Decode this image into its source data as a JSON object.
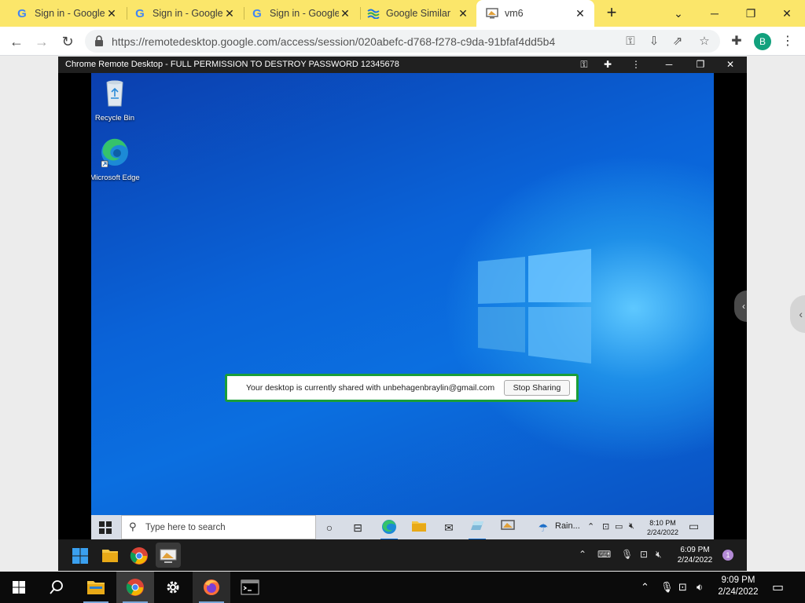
{
  "browser": {
    "tabs": [
      {
        "title": "Sign in - Google",
        "favicon": "google-icon"
      },
      {
        "title": "Sign in - Google",
        "favicon": "google-icon"
      },
      {
        "title": "Sign in - Google",
        "favicon": "google-icon"
      },
      {
        "title": "Google Similar",
        "favicon": "similar-icon"
      },
      {
        "title": "vm6",
        "favicon": "remote-desktop-icon"
      }
    ],
    "active_tab": 4,
    "url": "https://remotedesktop.google.com/access/session/020abefc-d768-f278-c9da-91bfaf4dd5b4",
    "profile_initial": "B"
  },
  "session": {
    "title": "Chrome Remote Desktop - FULL PERMISSION TO DESTROY PASSWORD 12345678"
  },
  "remote_desktop": {
    "icons": [
      {
        "label": "Recycle Bin"
      },
      {
        "label": "Microsoft Edge"
      }
    ],
    "share_banner": {
      "text": "Your desktop is currently shared with unbehagenbraylin@gmail.com",
      "button": "Stop Sharing"
    },
    "taskbar": {
      "search_placeholder": "Type here to search",
      "weather": "Rain...",
      "time": "8:10 PM",
      "date": "2/24/2022"
    }
  },
  "vm_taskbar": {
    "time": "6:09 PM",
    "date": "2/24/2022",
    "notifications": "1"
  },
  "host_taskbar": {
    "time": "9:09 PM",
    "date": "2/24/2022"
  },
  "colors": {
    "tabstrip": "#fbe66a",
    "share_border": "#1a9e3a",
    "profile": "#12a17d"
  }
}
